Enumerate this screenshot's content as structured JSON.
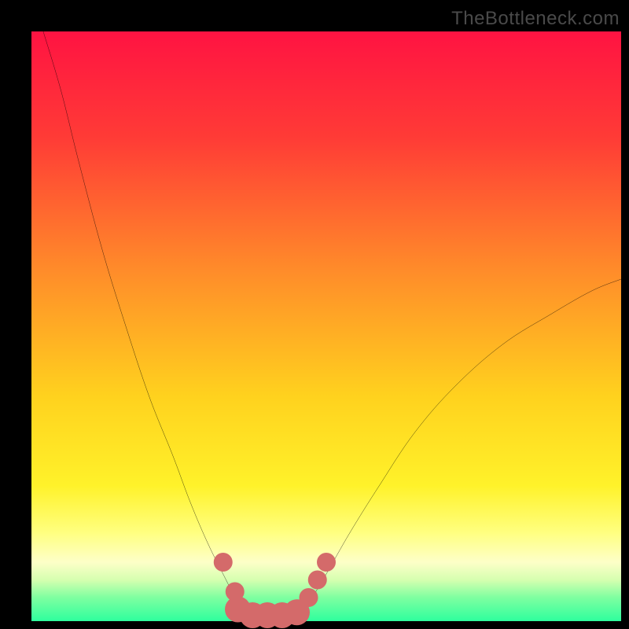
{
  "watermark": "TheBottleneck.com",
  "chart_data": {
    "type": "line",
    "title": "",
    "xlabel": "",
    "ylabel": "",
    "xlim": [
      0,
      100
    ],
    "ylim": [
      0,
      100
    ],
    "gradient_stops": [
      {
        "offset": 0.0,
        "color": "#ff1342"
      },
      {
        "offset": 0.18,
        "color": "#ff3b36"
      },
      {
        "offset": 0.4,
        "color": "#ff8a2a"
      },
      {
        "offset": 0.62,
        "color": "#ffd21e"
      },
      {
        "offset": 0.77,
        "color": "#fff22a"
      },
      {
        "offset": 0.85,
        "color": "#ffff80"
      },
      {
        "offset": 0.9,
        "color": "#fdffc8"
      },
      {
        "offset": 0.93,
        "color": "#d6ffb0"
      },
      {
        "offset": 0.96,
        "color": "#7effa0"
      },
      {
        "offset": 1.0,
        "color": "#2eff9e"
      }
    ],
    "series": [
      {
        "name": "left-curve",
        "x": [
          2,
          5,
          8,
          12,
          16,
          20,
          24,
          27,
          30,
          33,
          35,
          37
        ],
        "y": [
          100,
          90,
          78,
          63,
          50,
          38,
          28,
          20,
          13,
          7,
          3,
          0
        ]
      },
      {
        "name": "right-curve",
        "x": [
          45,
          47,
          50,
          54,
          59,
          65,
          72,
          80,
          88,
          95,
          100
        ],
        "y": [
          0,
          3,
          8,
          15,
          23,
          32,
          40,
          47,
          52,
          56,
          58
        ]
      }
    ],
    "markers": {
      "name": "bottom-markers",
      "color": "#d46a6a",
      "points": [
        {
          "x": 32.5,
          "y": 10,
          "r": 1.6
        },
        {
          "x": 34.5,
          "y": 5,
          "r": 1.6
        },
        {
          "x": 35.0,
          "y": 2,
          "r": 2.2
        },
        {
          "x": 37.5,
          "y": 1,
          "r": 2.2
        },
        {
          "x": 40.0,
          "y": 1,
          "r": 2.2
        },
        {
          "x": 42.5,
          "y": 1,
          "r": 2.2
        },
        {
          "x": 45.0,
          "y": 1.5,
          "r": 2.2
        },
        {
          "x": 47.0,
          "y": 4,
          "r": 1.6
        },
        {
          "x": 48.5,
          "y": 7,
          "r": 1.6
        },
        {
          "x": 50.0,
          "y": 10,
          "r": 1.6
        }
      ]
    }
  }
}
